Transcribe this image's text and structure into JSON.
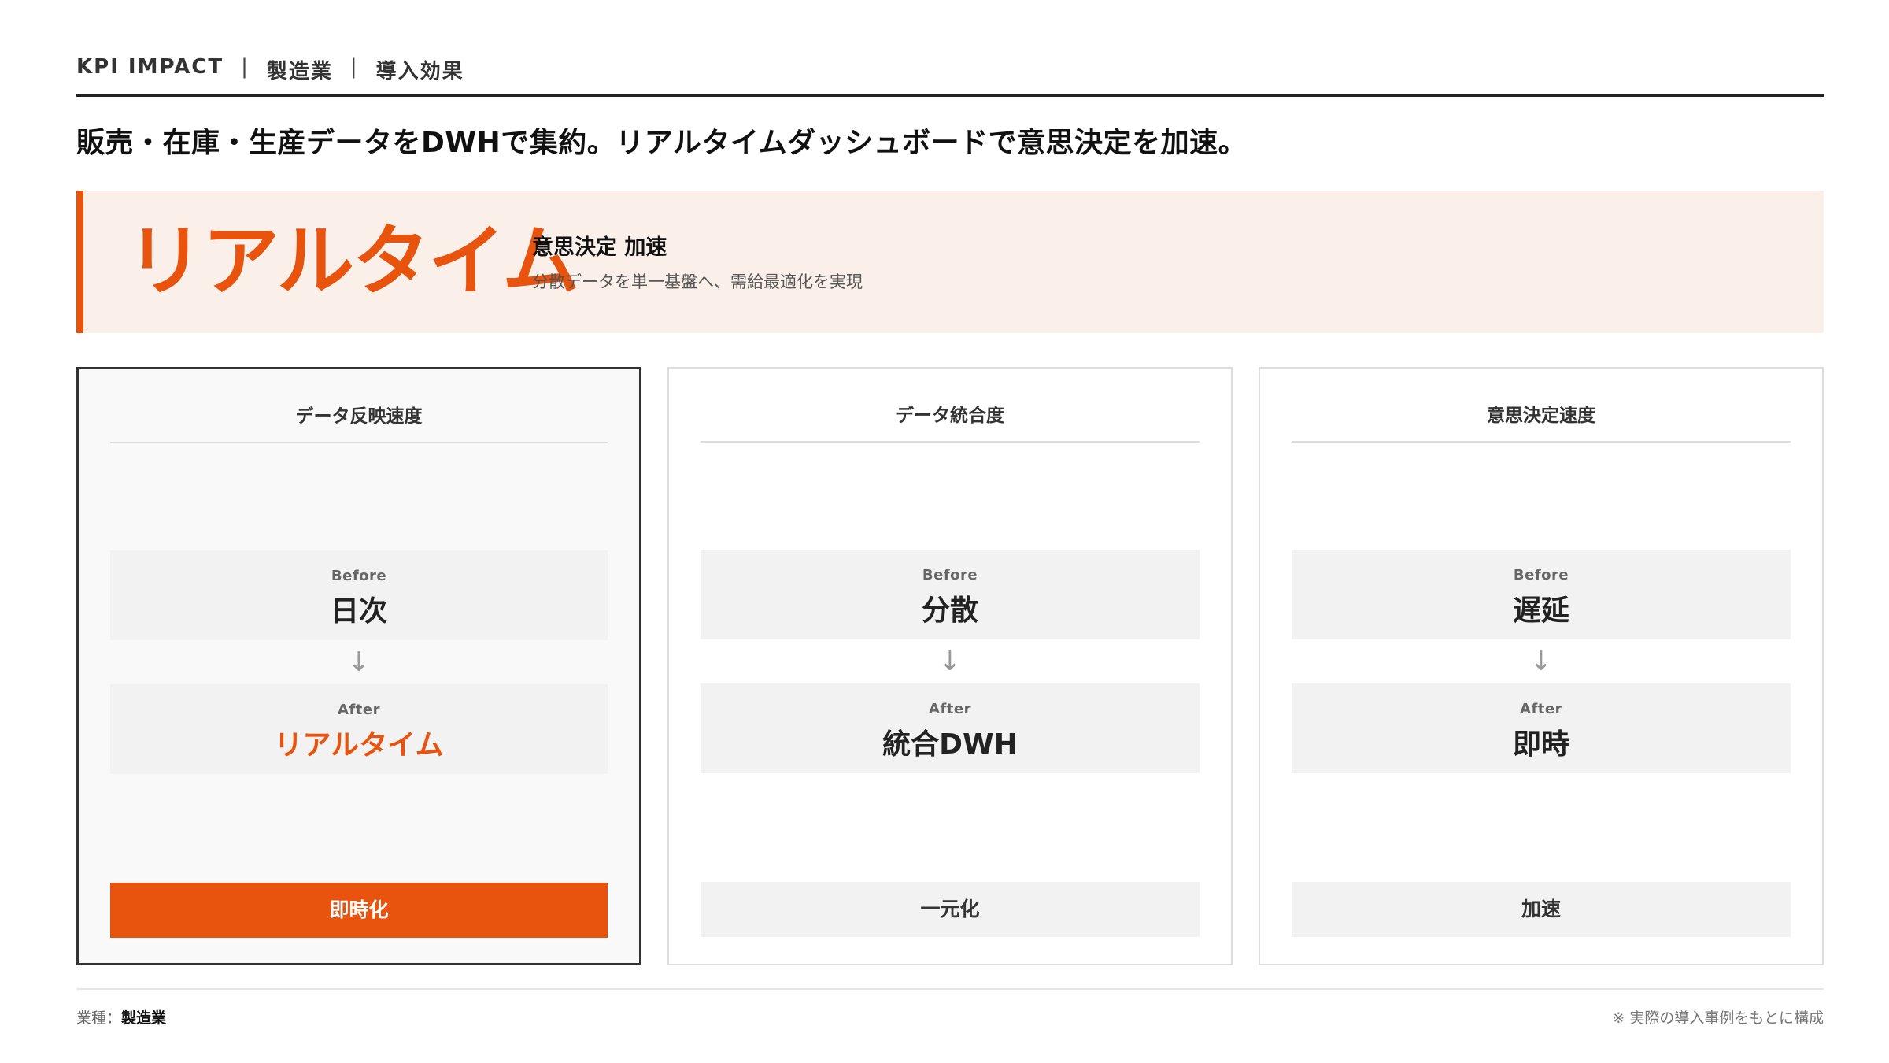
{
  "header": {
    "label": "KPI IMPACT",
    "separator": "|",
    "industry": "製造業",
    "section": "導入効果"
  },
  "headline": "販売・在庫・生産データをDWHで集約。リアルタイムダッシュボードで意思決定を加速。",
  "banner": {
    "big_text": "リアルタイム",
    "title": "意思決定 加速",
    "subtitle": "分散データを単一基盤へ、需給最適化を実現"
  },
  "cards": [
    {
      "title": "データ反映速度",
      "before_label": "Before",
      "before_value": "日次",
      "arrow": "↓",
      "after_label": "After",
      "after_value": "リアルタイム",
      "result": "即時化"
    },
    {
      "title": "データ統合度",
      "before_label": "Before",
      "before_value": "分散",
      "arrow": "↓",
      "after_label": "After",
      "after_value": "統合DWH",
      "result": "一元化"
    },
    {
      "title": "意思決定速度",
      "before_label": "Before",
      "before_value": "遅延",
      "arrow": "↓",
      "after_label": "After",
      "after_value": "即時",
      "result": "加速"
    }
  ],
  "footer": {
    "industry_label": "業種：",
    "industry_value": "製造業",
    "note": "※ 実際の導入事例をもとに構成"
  },
  "colors": {
    "accent": "#e8530e",
    "banner_bg": "#fbefe9",
    "box_bg": "#f2f2f2"
  }
}
